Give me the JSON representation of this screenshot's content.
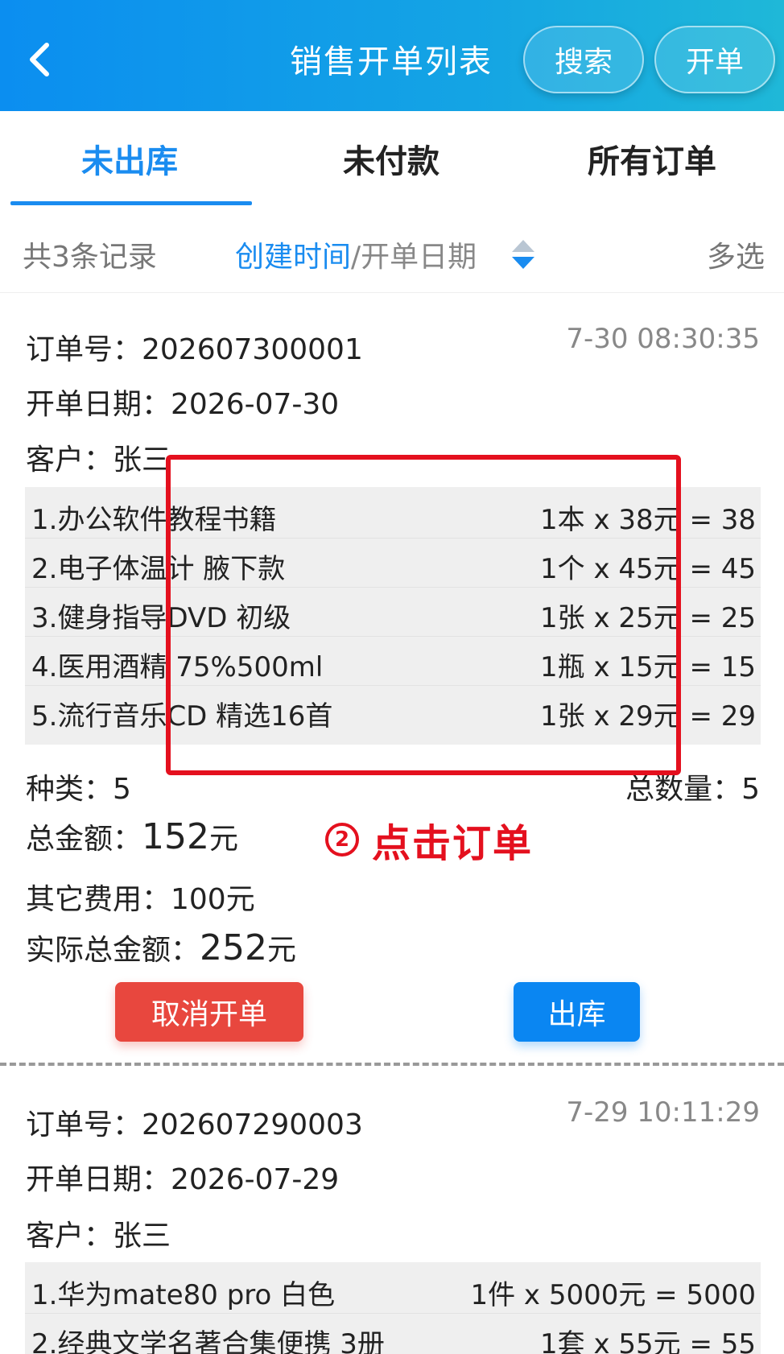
{
  "header": {
    "title": "销售开单列表",
    "search_label": "搜索",
    "open_label": "开单"
  },
  "tabs": [
    {
      "label": "未出库",
      "active": true
    },
    {
      "label": "未付款",
      "active": false
    },
    {
      "label": "所有订单",
      "active": false
    }
  ],
  "filter": {
    "count_text": "共3条记录",
    "sort_active": "创建时间",
    "sort_rest": "/开单日期",
    "multi_select": "多选"
  },
  "colors": {
    "accent": "#1a8cf0",
    "cancel": "#e8473e",
    "annotation": "#e4101e"
  },
  "orders": [
    {
      "order_no": "订单号：202607300001",
      "time": "7-30 08:30:35",
      "date": "开单日期：2026-07-30",
      "customer": "客户：张三",
      "items": [
        {
          "name": "1.办公软件教程书籍",
          "calc": "1本 x 38元 = 38"
        },
        {
          "name": "2.电子体温计 腋下款",
          "calc": "1个 x 45元 = 45"
        },
        {
          "name": "3.健身指导DVD 初级",
          "calc": "1张 x 25元 = 25"
        },
        {
          "name": "4.医用酒精 75%500ml",
          "calc": "1瓶 x 15元 = 15"
        },
        {
          "name": "5.流行音乐CD 精选16首",
          "calc": "1张 x 29元 = 29"
        }
      ],
      "kinds": "种类：5",
      "total_qty": "总数量：5",
      "total_label": "总金额：",
      "total_value": "152",
      "total_unit": "元",
      "other_fee": "其它费用：100元",
      "actual_label": "实际总金额：",
      "actual_value": "252",
      "actual_unit": "元",
      "cancel_label": "取消开单",
      "out_label": "出库"
    },
    {
      "order_no": "订单号：202607290003",
      "time": "7-29 10:11:29",
      "date": "开单日期：2026-07-29",
      "customer": "客户：张三",
      "items": [
        {
          "name": "1.华为mate80 pro 白色",
          "calc": "1件 x 5000元 = 5000"
        },
        {
          "name": "2.经典文学名著合集便携 3册",
          "calc": "1套 x 55元 = 55"
        }
      ]
    }
  ],
  "annotation": {
    "step_number": "2",
    "text": "点击订单"
  }
}
